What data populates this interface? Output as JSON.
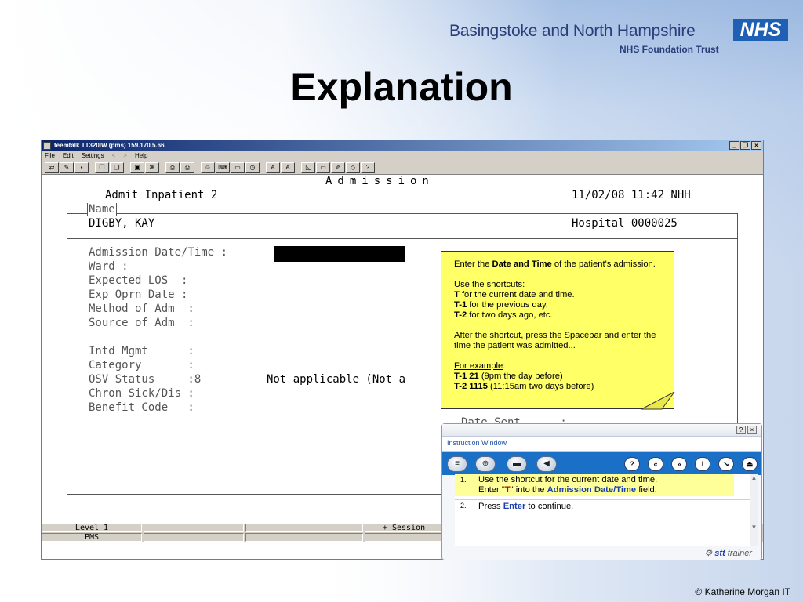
{
  "header": {
    "trust_name": "Basingstoke and North Hampshire",
    "trust_sub": "NHS Foundation Trust",
    "nhs_logo": "NHS",
    "colors": {
      "nhs_blue": "#1f5fb4",
      "trust_text": "#2b3e7a"
    }
  },
  "slide_title": "Explanation",
  "copyright": "© Katherine Morgan IT",
  "terminal": {
    "title": "teemtalk TT320IW (pms) 159.170.5.66",
    "window_buttons": [
      "_",
      "❐",
      "×"
    ],
    "menu": [
      "File",
      "Edit",
      "Settings",
      "<",
      ">",
      "Help"
    ],
    "screen": {
      "heading": "Admission",
      "screen_name": "Admit Inpatient 2",
      "datetime": "11/02/08 11:42 NHH",
      "name_label": "Name",
      "patient_name": "DIGBY, KAY",
      "hospital": "Hospital 0000025",
      "fields": {
        "admission_datetime": "Admission Date/Time :",
        "ward": "Ward :",
        "expected_los": "Expected LOS  :",
        "exp_oprn_date": "Exp Oprn Date :",
        "method_of_adm": "Method of Adm  :",
        "source_of_adm": "Source of Adm  :",
        "intd_mgmt": "Intd Mgmt      :",
        "category": "Category       :",
        "osv_status": "OSV Status     :8",
        "osv_status_desc": "Not applicable (Not a",
        "chron_sick": "Chron Sick/Dis :",
        "benefit_code": "Benefit Code   :",
        "date_sent": "Date Sent      :"
      }
    },
    "status_bar": {
      "level": "Level 1",
      "system": "PMS",
      "session": "+ Session"
    }
  },
  "callout": {
    "p1_pre": "Enter the ",
    "p1_bold": "Date and Time",
    "p1_post": " of the patient's admission.",
    "shortcuts_heading": "Use the shortcuts",
    "shortcuts_colon": ":",
    "s1_key": "T",
    "s1_text": " for the current date and time.",
    "s2_key": "T-1",
    "s2_text": " for the previous day,",
    "s3_key": "T-2",
    "s3_text": " for two days ago, etc.",
    "after": "After the shortcut, press the Spacebar and enter the time the patient was admitted...",
    "example_heading": "For example",
    "example_colon": ":",
    "e1_key": "T-1 21",
    "e1_text": " (9pm the day before)",
    "e2_key": "T-2 1115",
    "e2_text": " (11:15am two days before)"
  },
  "instruction_window": {
    "label": "Instruction Window",
    "top_buttons": [
      "?",
      "×"
    ],
    "toolbar_help": "?",
    "toolbar_info": "i",
    "step1_num": "1.",
    "step1_line1": "Use the shortcut for the current date and time.",
    "step1_pre": "Enter \"",
    "step1_key": "T",
    "step1_mid": "\" into the ",
    "step1_field": "Admission Date/Time",
    "step1_post": " field.",
    "step2_num": "2.",
    "step2_pre": "Press ",
    "step2_key": "Enter",
    "step2_post": " to continue.",
    "brand_stt": "stt",
    "brand_trainer": " trainer"
  }
}
